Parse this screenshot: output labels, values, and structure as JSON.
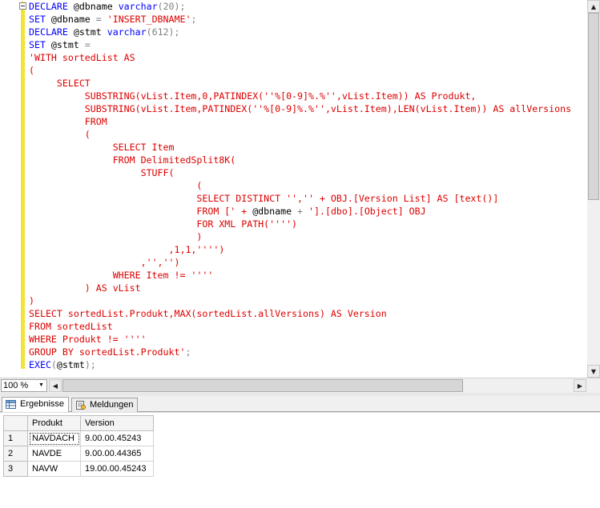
{
  "editor": {
    "lines": [
      [
        {
          "t": "DECLARE ",
          "c": "kw"
        },
        {
          "t": "@dbname ",
          "c": "var"
        },
        {
          "t": "varchar",
          "c": "kw"
        },
        {
          "t": "(20);",
          "c": "gry"
        }
      ],
      [
        {
          "t": "SET ",
          "c": "kw"
        },
        {
          "t": "@dbname ",
          "c": "var"
        },
        {
          "t": "= ",
          "c": "gry"
        },
        {
          "t": "'INSERT_DBNAME'",
          "c": "str"
        },
        {
          "t": ";",
          "c": "gry"
        }
      ],
      [
        {
          "t": "DECLARE ",
          "c": "kw"
        },
        {
          "t": "@stmt ",
          "c": "var"
        },
        {
          "t": "varchar",
          "c": "kw"
        },
        {
          "t": "(612);",
          "c": "gry"
        }
      ],
      [
        {
          "t": "SET ",
          "c": "kw"
        },
        {
          "t": "@stmt ",
          "c": "var"
        },
        {
          "t": "=",
          "c": "gry"
        }
      ],
      [
        {
          "t": "'WITH sortedList AS",
          "c": "str"
        }
      ],
      [
        {
          "t": "(",
          "c": "str"
        }
      ],
      [
        {
          "t": "     SELECT",
          "c": "str"
        }
      ],
      [
        {
          "t": "          SUBSTRING(vList.Item,0,PATINDEX(''%[0-9]%.%'',vList.Item)) AS Produkt,",
          "c": "str"
        }
      ],
      [
        {
          "t": "          SUBSTRING(vList.Item,PATINDEX(''%[0-9]%.%'',vList.Item),LEN(vList.Item)) AS allVersions",
          "c": "str"
        }
      ],
      [
        {
          "t": "          FROM",
          "c": "str"
        }
      ],
      [
        {
          "t": "          (",
          "c": "str"
        }
      ],
      [
        {
          "t": "               SELECT Item",
          "c": "str"
        }
      ],
      [
        {
          "t": "               FROM DelimitedSplit8K(",
          "c": "str"
        }
      ],
      [
        {
          "t": "                    STUFF(",
          "c": "str"
        }
      ],
      [
        {
          "t": "                              (",
          "c": "str"
        }
      ],
      [
        {
          "t": "                              SELECT DISTINCT '','' + OBJ.[Version List] AS [text()]",
          "c": "str"
        }
      ],
      [
        {
          "t": "                              FROM [' + ",
          "c": "str"
        },
        {
          "t": "@dbname",
          "c": "var"
        },
        {
          "t": " + ",
          "c": "gry"
        },
        {
          "t": "'].[dbo].[Object] OBJ",
          "c": "str"
        }
      ],
      [
        {
          "t": "                              FOR XML PATH('''')",
          "c": "str"
        }
      ],
      [
        {
          "t": "                              )",
          "c": "str"
        }
      ],
      [
        {
          "t": "                         ,1,1,'''')",
          "c": "str"
        }
      ],
      [
        {
          "t": "                    ,'','')",
          "c": "str"
        }
      ],
      [
        {
          "t": "               WHERE Item != ''''",
          "c": "str"
        }
      ],
      [
        {
          "t": "          ) AS vList",
          "c": "str"
        }
      ],
      [
        {
          "t": ")",
          "c": "str"
        }
      ],
      [
        {
          "t": "SELECT sortedList.Produkt,MAX(sortedList.allVersions) AS Version",
          "c": "str"
        }
      ],
      [
        {
          "t": "FROM sortedList",
          "c": "str"
        }
      ],
      [
        {
          "t": "WHERE Produkt != ''''",
          "c": "str"
        }
      ],
      [
        {
          "t": "GROUP BY sortedList.Produkt'",
          "c": "str"
        },
        {
          "t": ";",
          "c": "gry"
        }
      ],
      [
        {
          "t": "EXEC",
          "c": "kw"
        },
        {
          "t": "(",
          "c": "gry"
        },
        {
          "t": "@stmt",
          "c": "var"
        },
        {
          "t": ");",
          "c": "gry"
        }
      ]
    ]
  },
  "zoom": {
    "value": "100 %"
  },
  "tabs": [
    {
      "label": "Ergebnisse",
      "icon": "grid-icon",
      "active": true
    },
    {
      "label": "Meldungen",
      "icon": "messages-icon",
      "active": false
    }
  ],
  "results": {
    "columns": [
      "Produkt",
      "Version"
    ],
    "rows": [
      {
        "num": "1",
        "cells": [
          "NAVDACH",
          "9.00.00.45243"
        ]
      },
      {
        "num": "2",
        "cells": [
          "NAVDE",
          "9.00.00.44365"
        ]
      },
      {
        "num": "3",
        "cells": [
          "NAVW",
          "19.00.00.45243"
        ]
      }
    ]
  },
  "colors": {
    "keyword": "#0000ff",
    "string": "#dd0000",
    "operator": "#808080",
    "change_bar": "#f2e23a"
  }
}
